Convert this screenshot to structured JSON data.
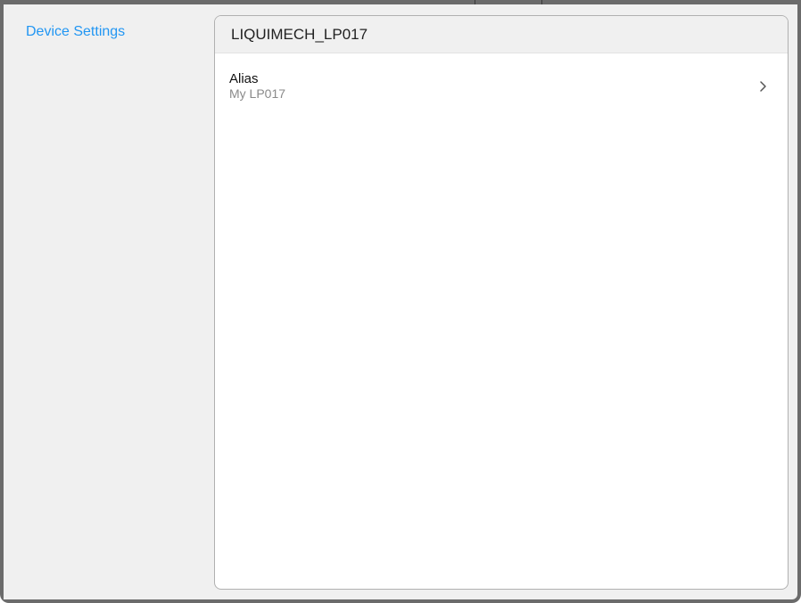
{
  "sidebar": {
    "items": [
      {
        "label": "Device Settings",
        "color": "#2196f3"
      }
    ]
  },
  "panel": {
    "title": "LIQUIMECH_LP017",
    "rows": [
      {
        "label": "Alias",
        "value": "My LP017",
        "icon": "chevron-right-icon"
      }
    ]
  }
}
